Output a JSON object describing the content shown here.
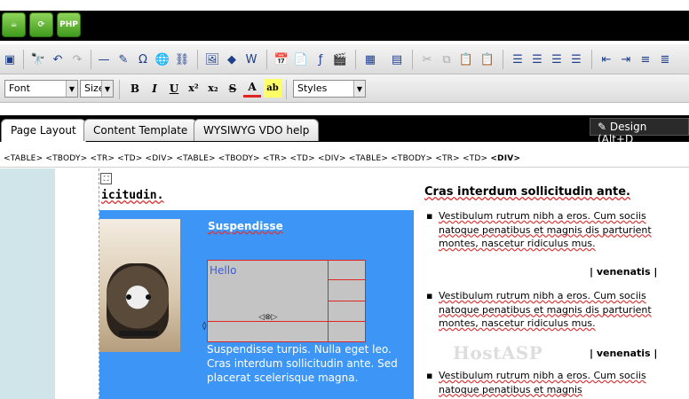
{
  "app_buttons": [
    {
      "name": "coffee-icon",
      "label": ""
    },
    {
      "name": "refresh-icon",
      "label": ""
    },
    {
      "name": "php-icon",
      "label": "PHP"
    }
  ],
  "toolbar": {
    "font_label": "Font",
    "size_label": "Size",
    "styles_label": "Styles",
    "bold": "B",
    "italic": "I",
    "underline": "U",
    "superscript": "x²",
    "subscript": "x₂",
    "strike": "S",
    "forecolor": "A",
    "highlight": "ab"
  },
  "tabs": [
    {
      "label": "Page Layout"
    },
    {
      "label": "Content Template"
    },
    {
      "label": "WYSIWYG VDO help"
    }
  ],
  "design_label": "Design (Alt+D",
  "tag_path": "<TABLE> <TBODY> <TR> <TD> <DIV> <TABLE> <TBODY> <TR> <TD> <DIV> <TABLE> <TBODY> <TR> <TD>",
  "tag_path_active": "<DIV>",
  "editor": {
    "heading": "icitudin.",
    "box_title": "Suspendisse",
    "cell_text": "Hello",
    "box_paragraph": "Suspendisse turpis. Nulla eget leo. Cras interdum sollicitudin ante. Sed placerat scelerisque magna.",
    "right_title": "Cras interdum sollicitudin ante.",
    "bullet_text": "Vestibulum rutrum nibh a eros. Cum sociis natoque penatibus et magnis dis parturient montes, nascetur ridiculus mus.",
    "bullet_text_short": "Vestibulum rutrum nibh a eros. Cum sociis natoque penatibus et magnis",
    "venenatis": "| venenatis |",
    "watermark": "HostASP"
  },
  "colors": {
    "box_blue": "#3d95f5",
    "left_panel": "#cfe5ea",
    "cell_border": "#e02424"
  }
}
